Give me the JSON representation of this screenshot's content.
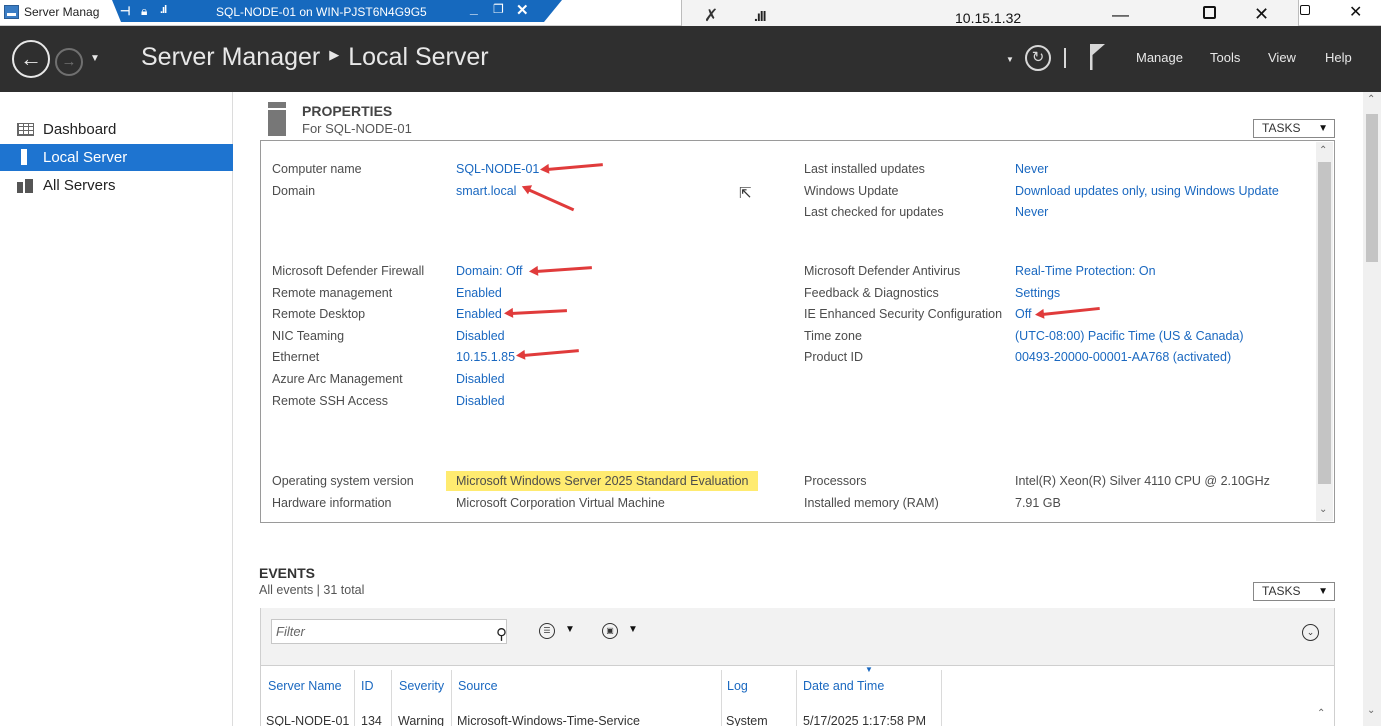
{
  "titlebar": {
    "app_title": "Server Manag"
  },
  "rdp_bar": {
    "title": "SQL-NODE-01 on WIN-PJST6N4G9G5"
  },
  "connection_bar": {
    "ip": "10.15.1.32"
  },
  "header": {
    "breadcrumb_root": "Server Manager",
    "breadcrumb_current": "Local Server",
    "menu": [
      "Manage",
      "Tools",
      "View",
      "Help"
    ]
  },
  "sidebar": {
    "items": [
      {
        "label": "Dashboard",
        "icon": "dashboard-icon",
        "selected": false
      },
      {
        "label": "Local Server",
        "icon": "server-icon",
        "selected": true
      },
      {
        "label": "All Servers",
        "icon": "servers-icon",
        "selected": false
      }
    ]
  },
  "properties": {
    "title": "PROPERTIES",
    "subtitle": "For SQL-NODE-01",
    "tasks_label": "TASKS",
    "left": [
      {
        "label": "Computer name",
        "value": "SQL-NODE-01",
        "link": true,
        "arrow": true
      },
      {
        "label": "Domain",
        "value": "smart.local",
        "link": true,
        "arrow": true
      },
      {
        "label": "Microsoft Defender Firewall",
        "value": "Domain: Off",
        "link": true,
        "arrow": true
      },
      {
        "label": "Remote management",
        "value": "Enabled",
        "link": true,
        "arrow": false
      },
      {
        "label": "Remote Desktop",
        "value": "Enabled",
        "link": true,
        "arrow": true
      },
      {
        "label": "NIC Teaming",
        "value": "Disabled",
        "link": true,
        "arrow": false
      },
      {
        "label": "Ethernet",
        "value": "10.15.1.85",
        "link": true,
        "arrow": true
      },
      {
        "label": "Azure Arc Management",
        "value": "Disabled",
        "link": true,
        "arrow": false
      },
      {
        "label": "Remote SSH Access",
        "value": "Disabled",
        "link": true,
        "arrow": false
      },
      {
        "label": "Operating system version",
        "value": "Microsoft Windows Server 2025 Standard Evaluation",
        "link": false,
        "highlight": true
      },
      {
        "label": "Hardware information",
        "value": "Microsoft Corporation Virtual Machine",
        "link": false
      }
    ],
    "right": [
      {
        "label": "Last installed updates",
        "value": "Never",
        "link": true
      },
      {
        "label": "Windows Update",
        "value": "Download updates only, using Windows Update",
        "link": true
      },
      {
        "label": "Last checked for updates",
        "value": "Never",
        "link": true
      },
      {
        "label": "Microsoft Defender Antivirus",
        "value": "Real-Time Protection: On",
        "link": true
      },
      {
        "label": "Feedback & Diagnostics",
        "value": "Settings",
        "link": true
      },
      {
        "label": "IE Enhanced Security Configuration",
        "value": "Off",
        "link": true,
        "arrow": true
      },
      {
        "label": "Time zone",
        "value": "(UTC-08:00) Pacific Time (US & Canada)",
        "link": true
      },
      {
        "label": "Product ID",
        "value": "00493-20000-00001-AA768 (activated)",
        "link": true
      },
      {
        "label": "Processors",
        "value": "Intel(R) Xeon(R) Silver 4110 CPU @ 2.10GHz",
        "link": false
      },
      {
        "label": "Installed memory (RAM)",
        "value": "7.91 GB",
        "link": false
      }
    ]
  },
  "events": {
    "title": "EVENTS",
    "subtitle": "All events | 31 total",
    "tasks_label": "TASKS",
    "filter_placeholder": "Filter",
    "columns": [
      "Server Name",
      "ID",
      "Severity",
      "Source",
      "Log",
      "Date and Time"
    ],
    "rows": [
      [
        "SQL-NODE-01",
        "134",
        "Warning",
        "Microsoft-Windows-Time-Service",
        "System",
        "5/17/2025 1:17:58 PM"
      ]
    ]
  },
  "colors": {
    "header_bg": "#2f2f2f",
    "nav_selected": "#1e74d0",
    "link": "#1a68c0",
    "highlight": "#ffeb70",
    "annotation_arrow": "#e03b3b",
    "rdp_bar": "#1669be"
  }
}
